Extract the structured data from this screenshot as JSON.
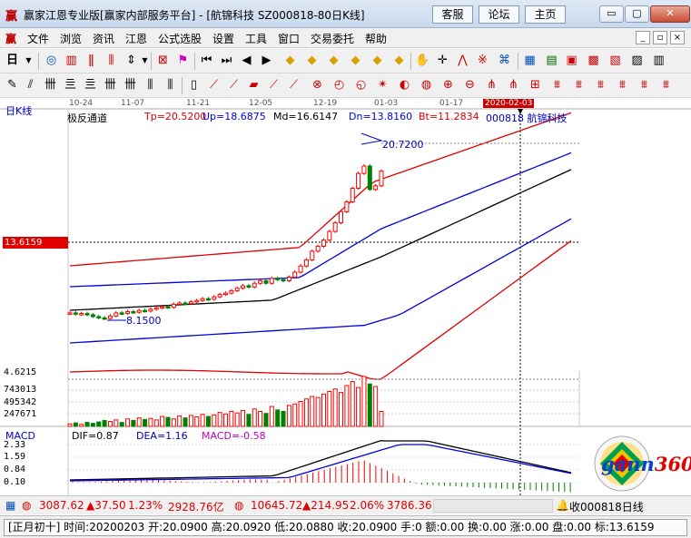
{
  "window": {
    "title": "赢家江恩专业版[赢家内部服务平台] - [航锦科技  SZ000818-80日K线]",
    "top_buttons": [
      "客服",
      "论坛",
      "主页"
    ],
    "controls": {
      "minimize": "▭",
      "restore": "▢",
      "close": "✕"
    }
  },
  "menu": {
    "items": [
      "文件",
      "浏览",
      "资讯",
      "江恩",
      "公式选股",
      "设置",
      "工具",
      "窗口",
      "交易委托",
      "帮助"
    ],
    "mdi_controls": [
      "_",
      "▫",
      "×"
    ]
  },
  "chart": {
    "period_label": "日K线",
    "dates": [
      "10-24",
      "11-07",
      "11-21",
      "12-05",
      "12-19",
      "01-03",
      "01-17"
    ],
    "cursor_date": "2020-02-03",
    "indicator": {
      "name": "极反通道",
      "Tp": "Tp=20.5200",
      "Up": "Up=18.6875",
      "Md": "Md=16.6147",
      "Dn": "Dn=13.8160",
      "Bt": "Bt=11.2834"
    },
    "stock_code": "000818",
    "stock_name": "航锦科技",
    "cross_price": "13.6159",
    "high_anno": "20.7200",
    "low_anno": "8.1500",
    "volume_axis": [
      "4.6215",
      "743013",
      "495342",
      "247671"
    ],
    "macd": {
      "title": "MACD",
      "dif": "DIF=0.87",
      "dea": "DEA=1.16",
      "macd": "MACD=-0.58",
      "axis": [
        "2.33",
        "1.59",
        "0.84",
        "0.10"
      ]
    },
    "colors": {
      "up": "#ff0000",
      "down": "#008000",
      "channel_outer": "#e00000",
      "channel_mid": "#0000e0",
      "center": "#000000"
    }
  },
  "chart_data": {
    "type": "candlestick",
    "stock": "000818 航锦科技",
    "period": "日K线",
    "closes": [
      8.6,
      8.5,
      8.55,
      8.45,
      8.3,
      8.2,
      8.15,
      8.35,
      8.6,
      8.55,
      8.7,
      8.65,
      8.8,
      8.75,
      8.9,
      9.0,
      9.1,
      9.05,
      9.3,
      9.4,
      9.35,
      9.5,
      9.6,
      9.75,
      9.7,
      9.9,
      10.1,
      10.2,
      10.4,
      10.6,
      10.8,
      10.7,
      11.0,
      11.2,
      11.0,
      11.4,
      11.3,
      11.2,
      11.5,
      11.9,
      12.4,
      12.9,
      13.6,
      14.0,
      14.5,
      15.2,
      15.9,
      16.8,
      17.6,
      18.7,
      19.9,
      20.5,
      18.6,
      18.9,
      20.09
    ],
    "macd": {
      "dif": 0.87,
      "dea": 1.16,
      "macd": -0.58
    },
    "channel": {
      "Tp": 20.52,
      "Up": 18.6875,
      "Md": 16.6147,
      "Dn": 13.816,
      "Bt": 11.2834
    },
    "high": 20.72,
    "low": 8.15
  },
  "index_bar": {
    "sh_value": "3087.62",
    "sh_change": "▲37.50",
    "sh_pct": "1.23%",
    "sh_amount": "2928.76亿",
    "sz_value": "10645.72",
    "sz_change": "▲214.95",
    "sz_pct": "2.06%",
    "sz_amount": "3786.36",
    "right_label": "收000818日线"
  },
  "status": {
    "text": "[正月初十] 时间:20200203 开:20.0900 高:20.0920 低:20.0880 收:20.0900 手:0 额:0.00 换:0.00 涨:0.00 盘:0.00 标:13.6159"
  },
  "gann": {
    "word": "gann",
    "num": "360"
  }
}
